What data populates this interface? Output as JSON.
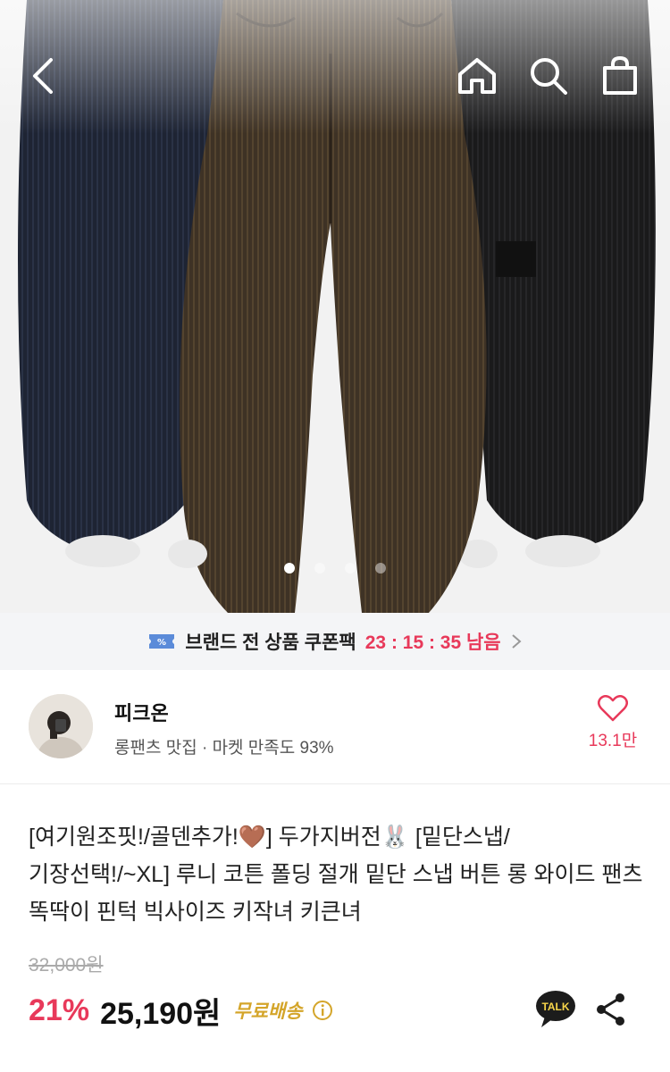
{
  "nav": {
    "back_icon": "chevron-left-icon",
    "home_icon": "home-icon",
    "search_icon": "search-icon",
    "bag_icon": "shopping-bag-icon"
  },
  "carousel": {
    "total_slides": 4,
    "active_index": 0
  },
  "coupon_banner": {
    "label": "브랜드 전 상품 쿠폰팩",
    "timer": "23 : 15 : 35 남음",
    "icon": "coupon-ticket-icon"
  },
  "shop": {
    "name": "피크온",
    "description": "롱팬츠 맛집 · 마켓 만족도 93%",
    "like_count": "13.1만"
  },
  "product": {
    "title": "[여기원조핏!/골덴추가!🤎] 두가지버전🐰 [밑단스냅/기장선택!/~XL] 루니 코튼 폴딩 절개 밑단 스냅 버튼 롱 와이드 팬츠 똑딱이 핀턱 빅사이즈 키작녀 키큰녀",
    "original_price": "32,000원",
    "discount": "21%",
    "price": "25,190원",
    "shipping": "무료배송",
    "talk_label": "TALK"
  },
  "colors": {
    "accent": "#e8395a",
    "shipping": "#d4a52a",
    "banner_bg": "#f4f5f7"
  }
}
